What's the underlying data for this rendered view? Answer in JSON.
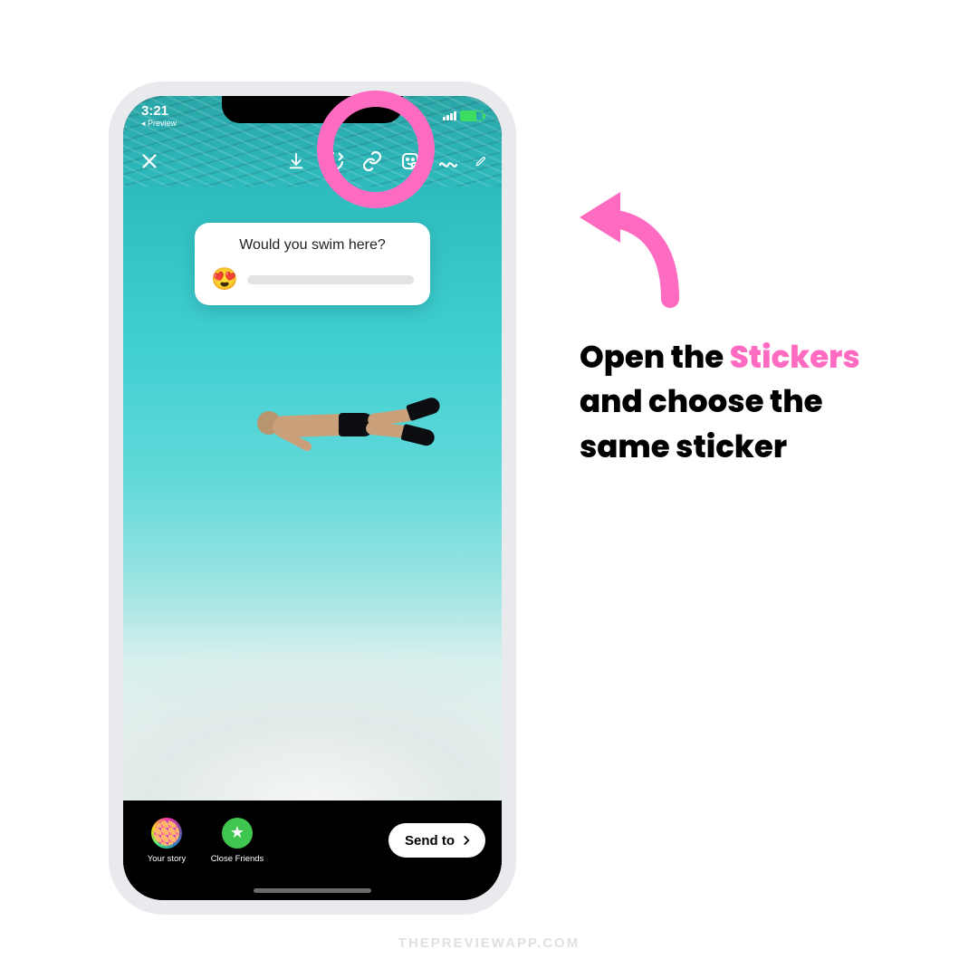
{
  "status": {
    "time": "3:21",
    "back_app": "◂ Preview"
  },
  "toolbar": {
    "close": "close-icon",
    "download": "download-icon",
    "boomerang": "boomerang-icon",
    "link": "link-icon",
    "sticker": "sticker-icon",
    "effects": "effects-icon",
    "draw": "draw-icon",
    "text": "text-icon"
  },
  "poll": {
    "question": "Would you swim here?",
    "emoji": "😍"
  },
  "share": {
    "your_story": "Your story",
    "close_friends": "Close Friends",
    "send_to": "Send to"
  },
  "instruction": {
    "part1": "Open the ",
    "highlight": "Stickers",
    "part2": " and choose the same sticker"
  },
  "watermark": "THEPREVIEWAPP.COM",
  "colors": {
    "pink": "#FF6BC1"
  }
}
